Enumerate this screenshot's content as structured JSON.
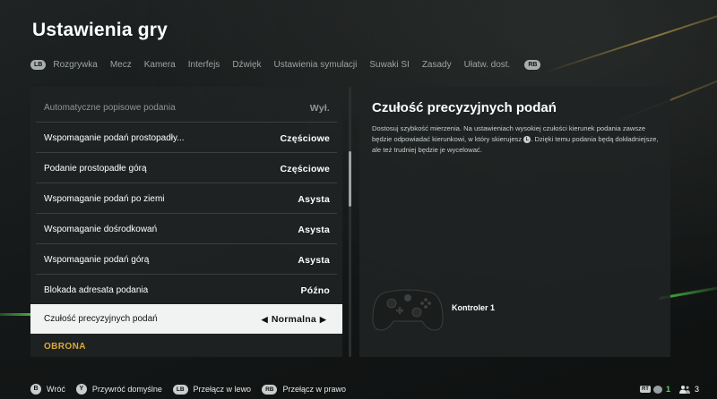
{
  "page_title": "Ustawienia gry",
  "tabs": {
    "left_bumper": "LB",
    "right_bumper": "RB",
    "items": [
      {
        "label": "Rozgrywka",
        "active": true
      },
      {
        "label": "Mecz",
        "active": false
      },
      {
        "label": "Kamera",
        "active": false
      },
      {
        "label": "Interfejs",
        "active": false
      },
      {
        "label": "Dźwięk",
        "active": false
      },
      {
        "label": "Ustawienia symulacji",
        "active": false
      },
      {
        "label": "Suwaki SI",
        "active": false
      },
      {
        "label": "Zasady",
        "active": false
      },
      {
        "label": "Ułatw. dost.",
        "active": false
      }
    ]
  },
  "settings": {
    "rows": [
      {
        "label": "Automatyczne popisowe podania",
        "value": "Wył.",
        "state": "dim"
      },
      {
        "label": "Wspomaganie podań prostopadły...",
        "value": "Częściowe",
        "state": "normal"
      },
      {
        "label": "Podanie prostopadłe górą",
        "value": "Częściowe",
        "state": "normal"
      },
      {
        "label": "Wspomaganie podań po ziemi",
        "value": "Asysta",
        "state": "normal"
      },
      {
        "label": "Wspomaganie dośrodkowań",
        "value": "Asysta",
        "state": "normal"
      },
      {
        "label": "Wspomaganie podań górą",
        "value": "Asysta",
        "state": "normal"
      },
      {
        "label": "Blokada adresata podania",
        "value": "Późno",
        "state": "normal"
      },
      {
        "label": "Czułość precyzyjnych podań",
        "value": "Normalna",
        "state": "selected"
      }
    ],
    "section_label": "OBRONA",
    "arrow_left": "◀",
    "arrow_right": "▶"
  },
  "detail": {
    "title": "Czułość precyzyjnych podań",
    "description_before": "Dostosuj szybkość mierzenia. Na ustawieniach wysokiej czułości kierunek podania zawsze będzie odpowiadać kierunkowi, w który skierujesz",
    "stick_glyph": "L",
    "description_after": ". Dzięki temu podania będą dokładniejsze, ale też trudniej będzie je wycelować.",
    "controller_label": "Kontroler 1"
  },
  "footer": {
    "items": [
      {
        "glyph": "B",
        "label": "Wróć",
        "type": "circle"
      },
      {
        "glyph": "Y",
        "label": "Przywróć domyślne",
        "type": "circle"
      },
      {
        "glyph": "LB",
        "label": "Przełącz w lewo",
        "type": "pill"
      },
      {
        "glyph": "RB",
        "label": "Przełącz w prawo",
        "type": "pill"
      }
    ]
  },
  "status": {
    "trigger": "RT",
    "controllers": "1",
    "players": "3"
  }
}
